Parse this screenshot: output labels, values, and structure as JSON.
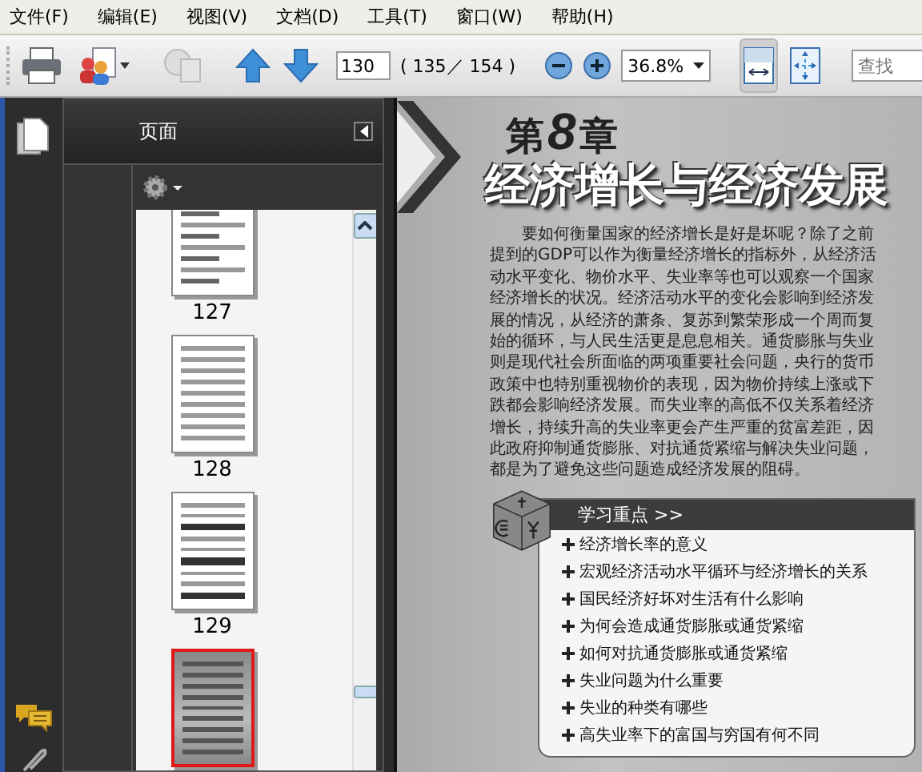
{
  "menu": [
    "文件(F)",
    "编辑(E)",
    "视图(V)",
    "文档(D)",
    "工具(T)",
    "窗口(W)",
    "帮助(H)"
  ],
  "toolbar": {
    "page_input": "130",
    "page_count": "( 135／ 154 )",
    "zoom": "36.8%",
    "fit_width_selected": true,
    "fit_page_selected": false,
    "search": {
      "placeholder": "查找"
    }
  },
  "panel": {
    "title": "页面",
    "thumbnails": [
      {
        "label": "127",
        "kind": "diagram",
        "selected": false
      },
      {
        "label": "128",
        "kind": "text",
        "selected": false
      },
      {
        "label": "129",
        "kind": "table",
        "selected": false
      },
      {
        "kind": "cover",
        "selected": true
      }
    ]
  },
  "document": {
    "chapter_prefix": "第",
    "chapter_number": "8",
    "chapter_suffix": "章",
    "title": "经济增长与经济发展",
    "paragraph": "要如何衡量国家的经济增长是好是坏呢？除了之前提到的GDP可以作为衡量经济增长的指标外，从经济活动水平变化、物价水平、失业率等也可以观察一个国家经济增长的状况。经济活动水平的变化会影响到经济发展的情况，从经济的萧条、复苏到繁荣形成一个周而复始的循环，与人民生活更是息息相关。通货膨胀与失业则是现代社会所面临的两项重要社会问题，央行的货币政策中也特别重视物价的表现，因为物价持续上涨或下跌都会影响经济发展。而失业率的高低不仅关系着经济增长，持续升高的失业率更会产生严重的贫富差距，因此政府抑制通货膨胀、对抗通货紧缩与解决失业问题，都是为了避免这些问题造成经济发展的阻碍。",
    "key_points": {
      "heading": "学习重点 >>",
      "items": [
        "经济增长率的意义",
        "宏观经济活动水平循环与经济增长的关系",
        "国民经济好坏对生活有什么影响",
        "为何会造成通货膨胀或通货紧缩",
        "如何对抗通货膨胀或通货紧缩",
        "失业问题为什么重要",
        "失业的种类有哪些",
        "高失业率下的富国与穷国有何不同"
      ]
    }
  }
}
